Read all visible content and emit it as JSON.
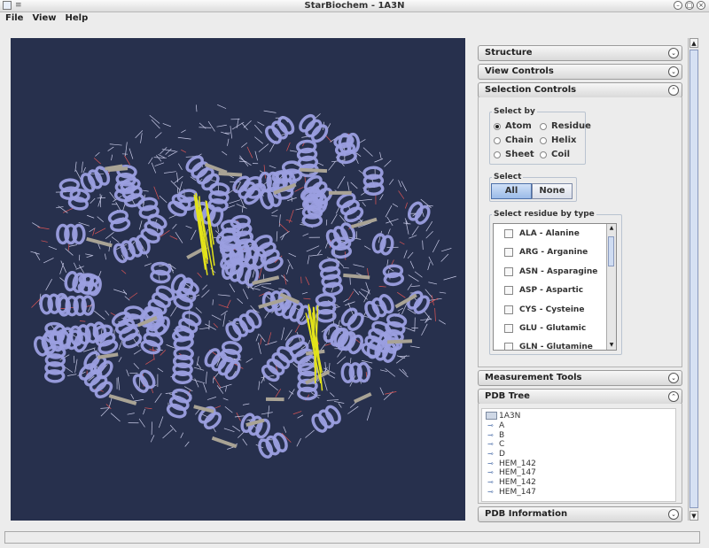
{
  "window": {
    "title": "StarBiochem - 1A3N"
  },
  "menu": [
    {
      "label": "File"
    },
    {
      "label": "View"
    },
    {
      "label": "Help"
    }
  ],
  "panels": {
    "structure": "Structure",
    "view_controls": "View Controls",
    "selection_controls": "Selection Controls",
    "measurement_tools": "Measurement Tools",
    "pdb_tree": "PDB Tree",
    "pdb_information": "PDB Information"
  },
  "selection": {
    "select_by_label": "Select by",
    "options": [
      "Atom",
      "Residue",
      "Chain",
      "Helix",
      "Sheet",
      "Coil"
    ],
    "selected": "Atom",
    "select_label": "Select",
    "all_label": "All",
    "none_label": "None",
    "residue_type_label": "Select residue by type",
    "residues": [
      "ALA - Alanine",
      "ARG - Arganine",
      "ASN - Asparagine",
      "ASP - Aspartic",
      "CYS - Cysteine",
      "GLU - Glutamic",
      "GLN - Glutamine"
    ]
  },
  "tree": {
    "root": "1A3N",
    "children": [
      "A",
      "B",
      "C",
      "D",
      "HEM_142",
      "HEM_147",
      "HEM_142",
      "HEM_147"
    ]
  },
  "colors": {
    "viewer_bg": "#27304d",
    "helix": "#9b9fe0",
    "sheet": "#a9a395",
    "heme": "#e3e31a"
  }
}
